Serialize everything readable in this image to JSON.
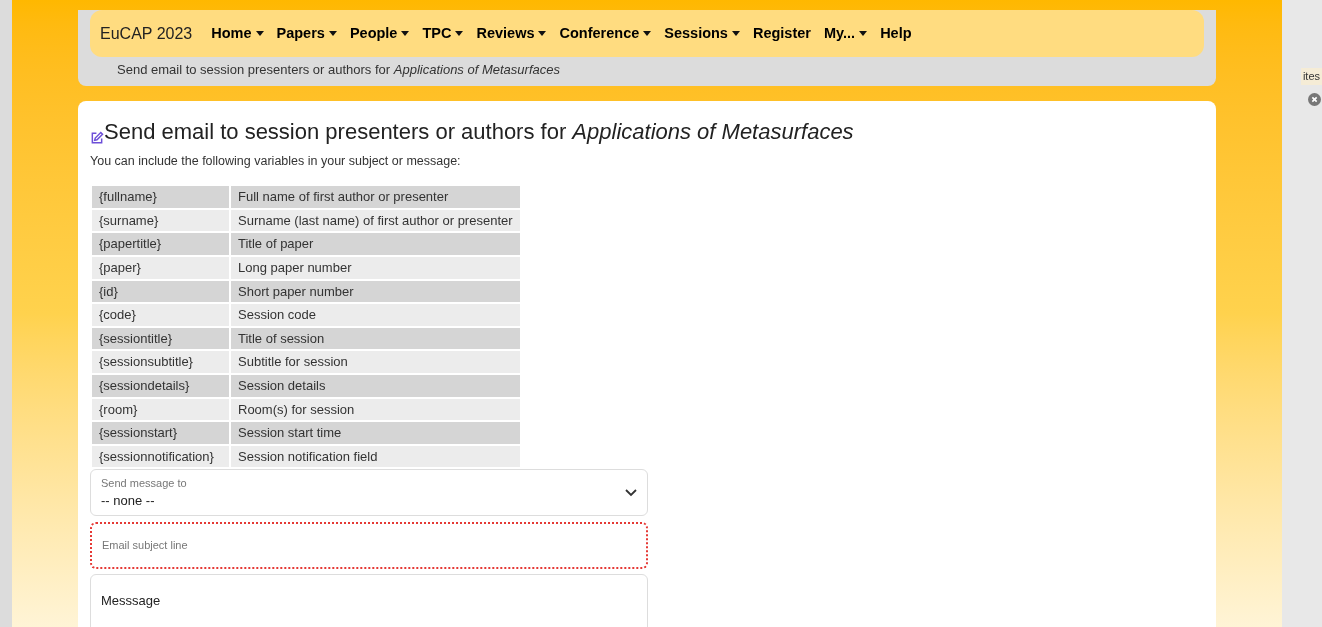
{
  "navbar": {
    "brand": "EuCAP 2023",
    "items": [
      {
        "label": "Home",
        "dropdown": true
      },
      {
        "label": "Papers",
        "dropdown": true
      },
      {
        "label": "People",
        "dropdown": true
      },
      {
        "label": "TPC",
        "dropdown": true
      },
      {
        "label": "Reviews",
        "dropdown": true
      },
      {
        "label": "Conference",
        "dropdown": true
      },
      {
        "label": "Sessions",
        "dropdown": true
      },
      {
        "label": "Register",
        "dropdown": false
      },
      {
        "label": "My...",
        "dropdown": true
      },
      {
        "label": "Help",
        "dropdown": false
      }
    ]
  },
  "breadcrumb": "Send email to session presenters or authors for *Applications of Metasurfaces*",
  "heading": "Send email to session presenters or authors for *Applications of Metasurfaces*",
  "intro": "You can include the following variables in your subject or message:",
  "variables": [
    {
      "name": "{fullname}",
      "description": "Full name of first author or presenter"
    },
    {
      "name": "{surname}",
      "description": "Surname (last name) of first author or presenter"
    },
    {
      "name": "{papertitle}",
      "description": "Title of paper"
    },
    {
      "name": "{paper}",
      "description": "Long paper number"
    },
    {
      "name": "{id}",
      "description": "Short paper number"
    },
    {
      "name": "{code}",
      "description": "Session code"
    },
    {
      "name": "{sessiontitle}",
      "description": "Title of session"
    },
    {
      "name": "{sessionsubtitle}",
      "description": "Subtitle for session"
    },
    {
      "name": "{sessiondetails}",
      "description": "Session details"
    },
    {
      "name": "{room}",
      "description": "Room(s) for session"
    },
    {
      "name": "{sessionstart}",
      "description": "Session start time"
    },
    {
      "name": "{sessionnotification}",
      "description": "Session notification field"
    }
  ],
  "recipient_select": {
    "label": "Send message to",
    "value": "-- none --"
  },
  "subject_field": {
    "label": "Email subject line",
    "invalid": true
  },
  "message_field": {
    "placeholder": "Messsage"
  },
  "side_window": {
    "tab_text": "ites"
  }
}
